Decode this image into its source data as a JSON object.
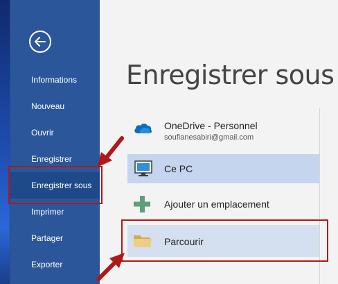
{
  "backstage": {
    "back_button_icon": "back-arrow-icon",
    "items": [
      {
        "label": "Informations"
      },
      {
        "label": "Nouveau"
      },
      {
        "label": "Ouvrir"
      },
      {
        "label": "Enregistrer"
      },
      {
        "label": "Enregistrer sous",
        "selected": true
      },
      {
        "label": "Imprimer"
      },
      {
        "label": "Partager"
      },
      {
        "label": "Exporter"
      }
    ]
  },
  "main": {
    "title": "Enregistrer sous",
    "locations": [
      {
        "name": "OneDrive - Personnel",
        "sub": "soufianesabiri@gmail.com",
        "icon": "onedrive-cloud-icon"
      },
      {
        "name": "Ce PC",
        "icon": "computer-icon",
        "selected": true
      },
      {
        "name": "Ajouter un emplacement",
        "icon": "plus-icon"
      },
      {
        "name": "Parcourir",
        "icon": "folder-icon"
      }
    ]
  },
  "colors": {
    "backstage": "#2b579a",
    "backstage_selected": "#1e4a8a",
    "annotation_red": "#b01818",
    "onedrive_blue": "#0f6cbd",
    "plus_green": "#5e9e7d",
    "folder_tan": "#e8c37a"
  }
}
